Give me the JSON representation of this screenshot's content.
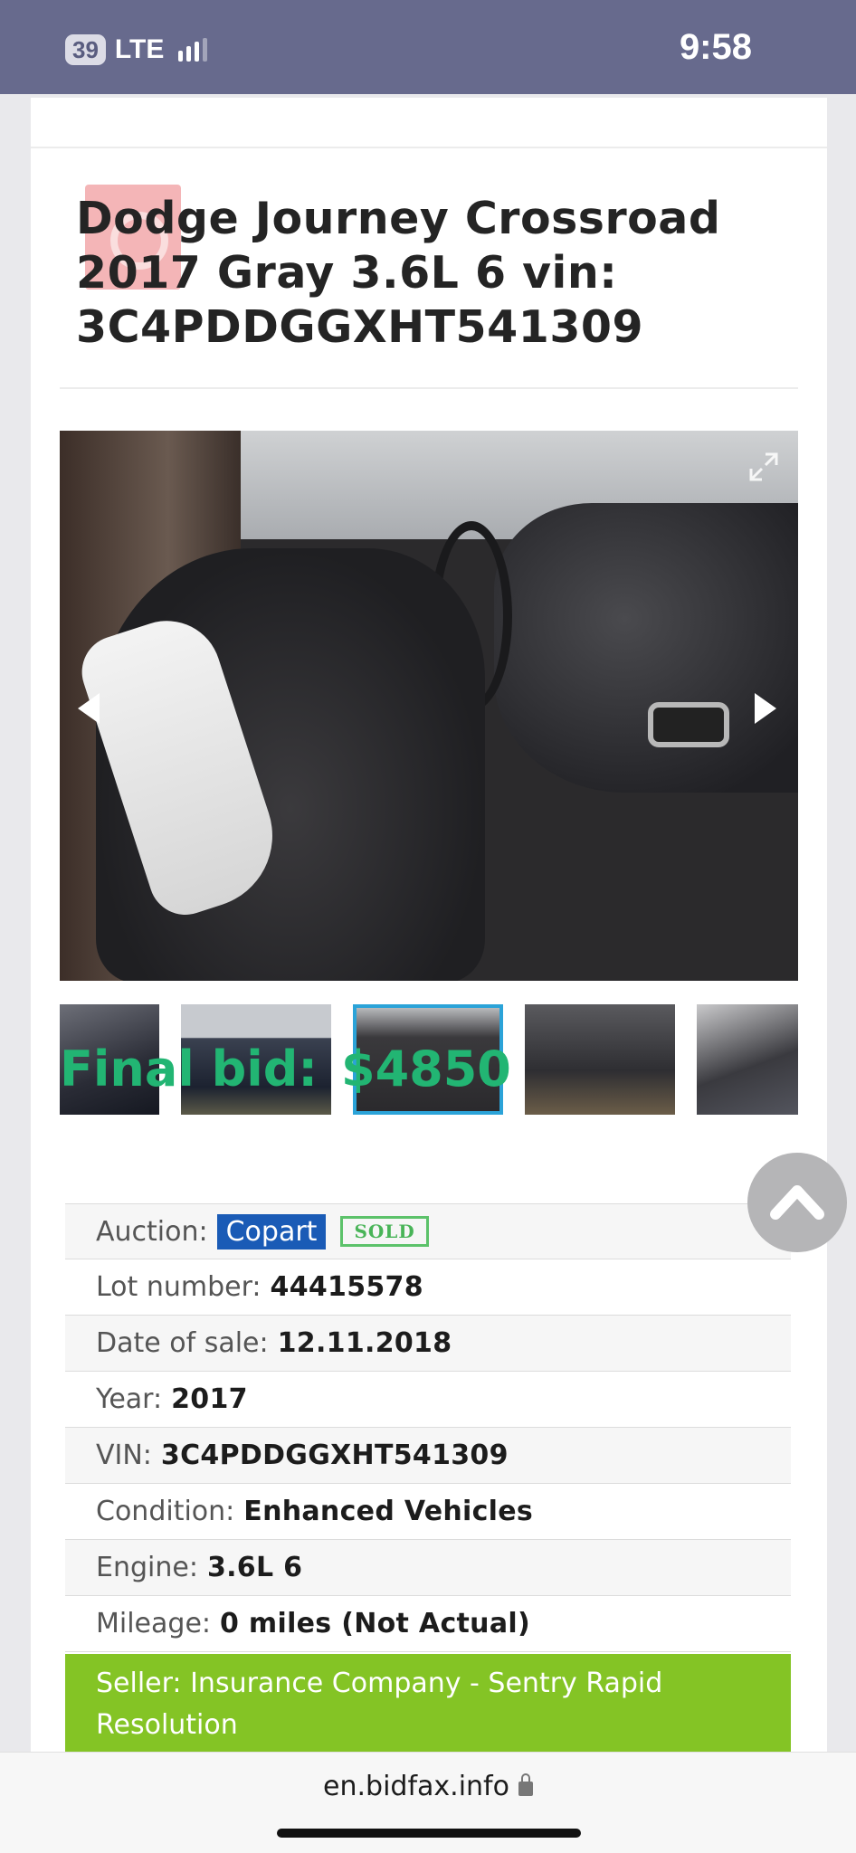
{
  "status_bar": {
    "battery": "39",
    "network": "LTE",
    "time": "9:58"
  },
  "listing": {
    "title": "Dodge Journey Crossroad 2017 Gray 3.6L 6 vin: 3C4PDDGGXHT541309",
    "final_bid_label": "Final bid:",
    "final_bid_value": "$4850",
    "details": [
      {
        "label": "Auction:",
        "value": "Copart",
        "badge": "SOLD"
      },
      {
        "label": "Lot number:",
        "value": "44415578"
      },
      {
        "label": "Date of sale:",
        "value": "12.11.2018"
      },
      {
        "label": "Year:",
        "value": "2017"
      },
      {
        "label": "VIN:",
        "value": "3C4PDDGGXHT541309"
      },
      {
        "label": "Condition:",
        "value": "Enhanced Vehicles"
      },
      {
        "label": "Engine:",
        "value": "3.6L 6"
      },
      {
        "label": "Mileage:",
        "value": "0 miles (Not Actual)"
      }
    ],
    "seller": "Seller: Insurance Company - Sentry Rapid Resolution"
  },
  "gallery": {
    "thumb_count": 5,
    "active_index": 2
  },
  "browser": {
    "url": "en.bidfax.info"
  },
  "colors": {
    "status_bar": "#676a8d",
    "accent_green": "#22b573",
    "copart_blue": "#1a5bb6",
    "seller_green": "#84c425",
    "thumb_active": "#2ba3d8"
  },
  "icons": [
    "signal-icon",
    "expand-icon",
    "arrow-left-icon",
    "arrow-right-icon",
    "scroll-top-icon",
    "lock-icon"
  ]
}
